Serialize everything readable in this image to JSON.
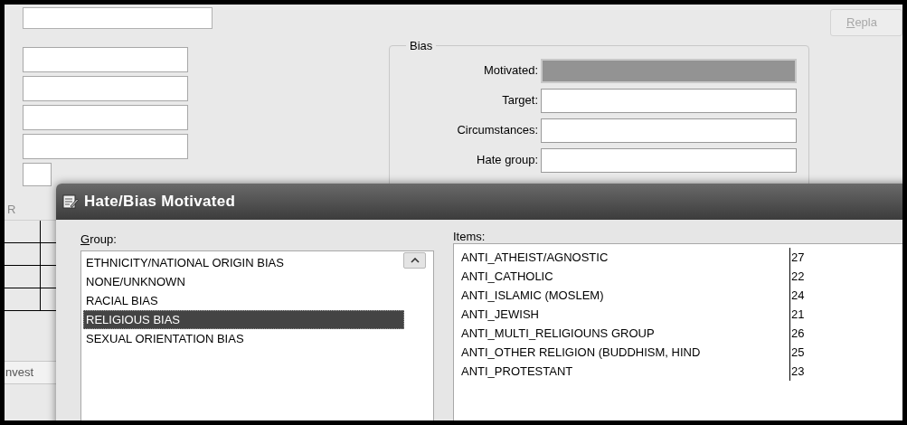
{
  "background": {
    "replace_button": {
      "label": "Repla",
      "disabled": true,
      "access_key_underlined": true
    },
    "bias": {
      "title": "Bias",
      "fields": [
        {
          "label": "Motivated:",
          "disabled": true
        },
        {
          "label": "Target:",
          "disabled": false
        },
        {
          "label": "Circumstances:",
          "disabled": false
        },
        {
          "label": "Hate group:",
          "disabled": false
        }
      ]
    },
    "grid_header": "R",
    "tab_label": "nvest"
  },
  "dialog": {
    "title": "Hate/Bias Motivated",
    "group": {
      "label": "Group:",
      "access_key_underlined": true,
      "items": [
        {
          "label": "ETHNICITY/NATIONAL ORIGIN BIAS",
          "selected": false
        },
        {
          "label": "NONE/UNKNOWN",
          "selected": false
        },
        {
          "label": "RACIAL BIAS",
          "selected": false
        },
        {
          "label": "RELIGIOUS BIAS",
          "selected": true
        },
        {
          "label": "SEXUAL ORIENTATION BIAS",
          "selected": false
        }
      ]
    },
    "items": {
      "label": "Items:",
      "rows": [
        {
          "name": "ANTI_ATHEIST/AGNOSTIC",
          "code": "27"
        },
        {
          "name": "ANTI_CATHOLIC",
          "code": "22"
        },
        {
          "name": "ANTI_ISLAMIC (MOSLEM)",
          "code": "24"
        },
        {
          "name": "ANTI_JEWISH",
          "code": "21"
        },
        {
          "name": "ANTI_MULTI_RELIGIOUNS GROUP",
          "code": "26"
        },
        {
          "name": "ANTI_OTHER RELIGION (BUDDHISM, HIND",
          "code": "25"
        },
        {
          "name": "ANTI_PROTESTANT",
          "code": "23"
        }
      ]
    }
  }
}
